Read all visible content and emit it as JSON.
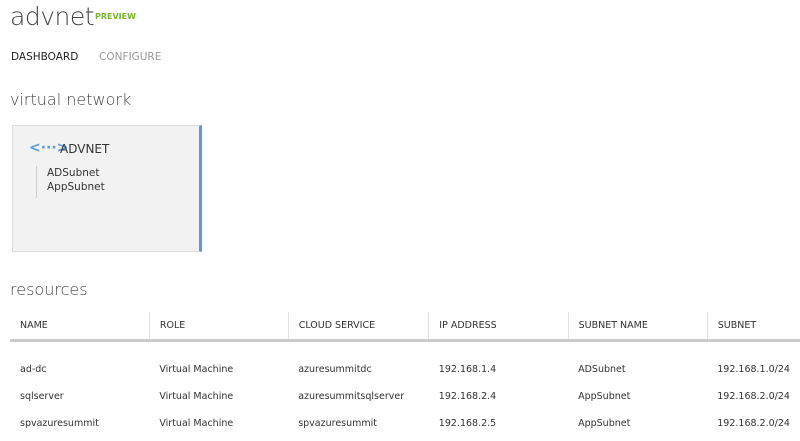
{
  "header": {
    "title": "advnet",
    "badge": "PREVIEW"
  },
  "tabs": [
    {
      "label": "DASHBOARD"
    },
    {
      "label": "CONFIGURE"
    }
  ],
  "virtual_network": {
    "heading": "virtual network",
    "card": {
      "icon": "virtual-network-icon",
      "title": "ADVNET",
      "subnets": [
        "ADSubnet",
        "AppSubnet"
      ]
    }
  },
  "resources": {
    "heading": "resources",
    "columns": [
      "NAME",
      "ROLE",
      "CLOUD SERVICE",
      "IP ADDRESS",
      "SUBNET NAME",
      "SUBNET"
    ],
    "rows": [
      [
        "ad-dc",
        "Virtual Machine",
        "azuresummitdc",
        "192.168.1.4",
        "ADSubnet",
        "192.168.1.0/24"
      ],
      [
        "sqlserver",
        "Virtual Machine",
        "azuresummitsqlserver",
        "192.168.2.4",
        "AppSubnet",
        "192.168.2.0/24"
      ],
      [
        "spvazuresummit",
        "Virtual Machine",
        "spvazuresummit",
        "192.168.2.5",
        "AppSubnet",
        "192.168.2.0/24"
      ]
    ]
  }
}
